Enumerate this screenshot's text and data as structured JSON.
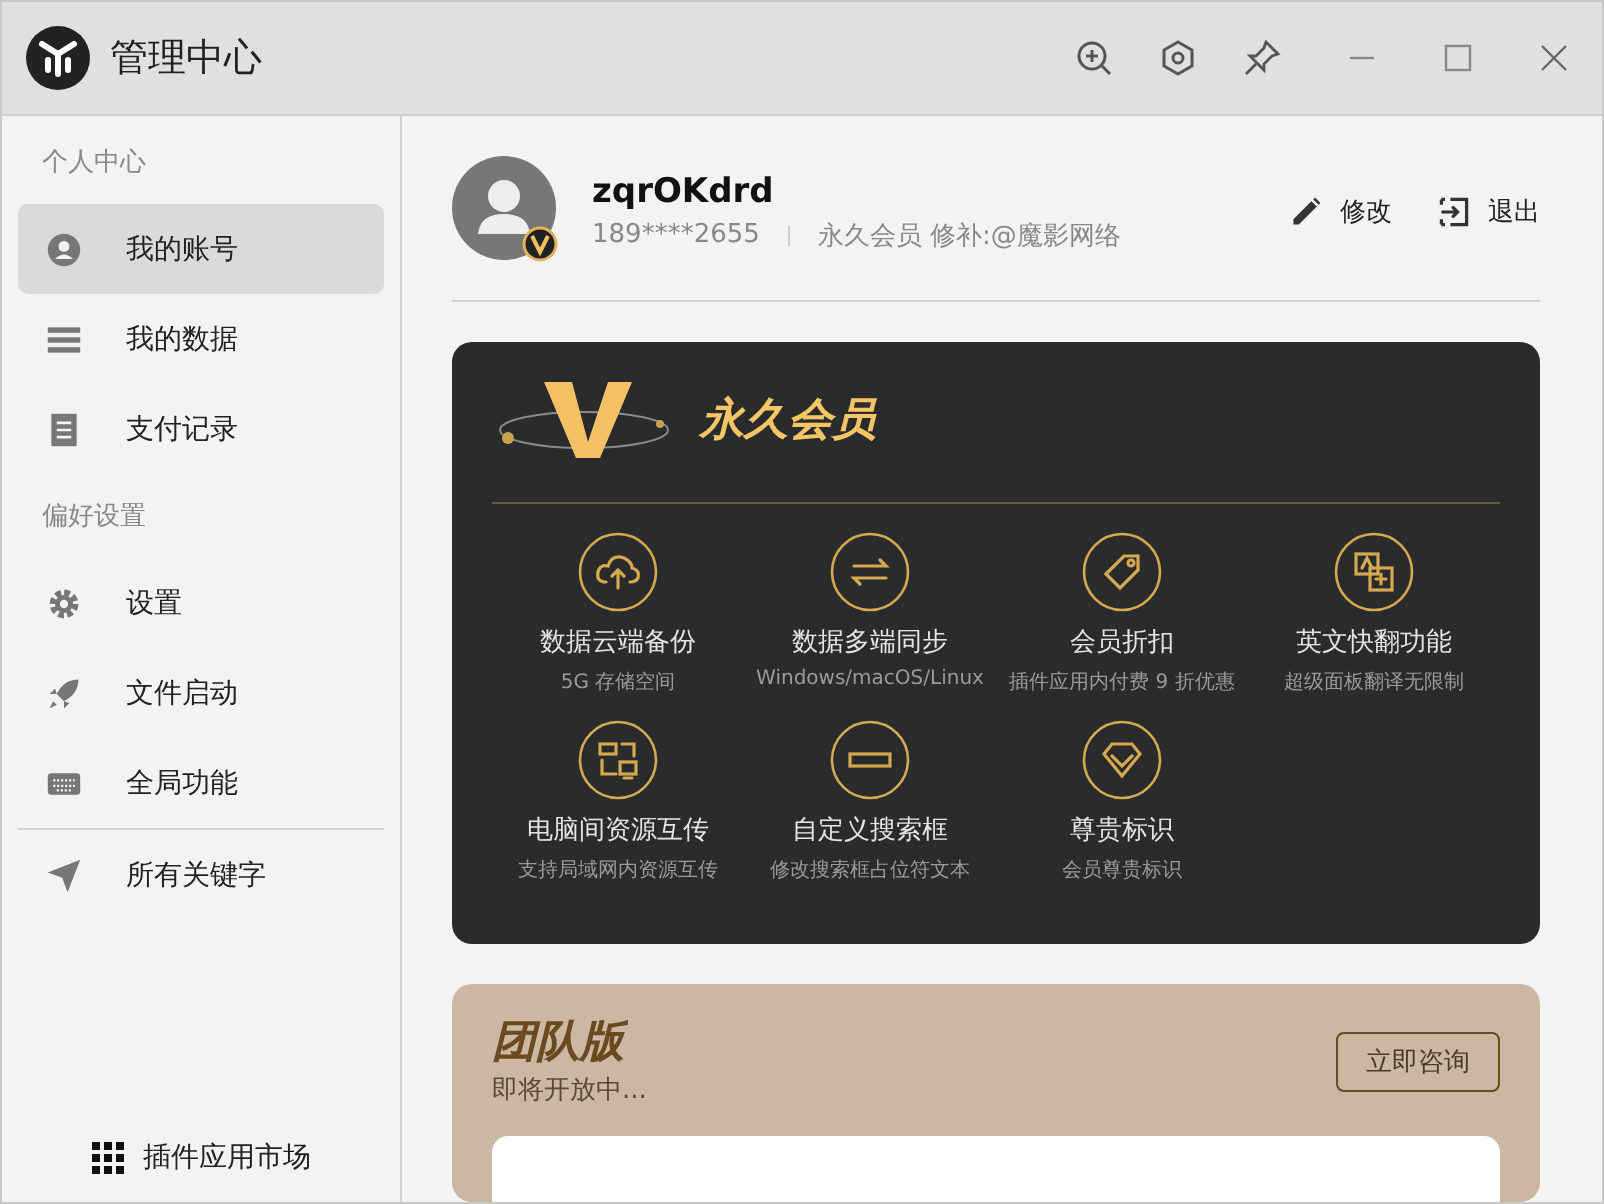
{
  "window": {
    "title": "管理中心"
  },
  "sidebar": {
    "groups": [
      {
        "heading": "个人中心",
        "items": [
          {
            "label": "我的账号",
            "selected": true
          },
          {
            "label": "我的数据",
            "selected": false
          },
          {
            "label": "支付记录",
            "selected": false
          }
        ]
      },
      {
        "heading": "偏好设置",
        "items": [
          {
            "label": "设置",
            "selected": false
          },
          {
            "label": "文件启动",
            "selected": false
          },
          {
            "label": "全局功能",
            "selected": false
          }
        ]
      },
      {
        "items": [
          {
            "label": "所有关键字",
            "selected": false
          }
        ]
      }
    ],
    "footer": "插件应用市场"
  },
  "profile": {
    "name": "zqrOKdrd",
    "phone": "189****2655",
    "membership": "永久会员 修补:@魔影网络",
    "actions": [
      "修改",
      "退出"
    ]
  },
  "vip_card": {
    "title": "永久会员",
    "features": [
      {
        "title": "数据云端备份",
        "subtitle": "5G 存储空间"
      },
      {
        "title": "数据多端同步",
        "subtitle": "Windows/macOS/Linux"
      },
      {
        "title": "会员折扣",
        "subtitle": "插件应用内付费 9 折优惠"
      },
      {
        "title": "英文快翻功能",
        "subtitle": "超级面板翻译无限制"
      },
      {
        "title": "电脑间资源互传",
        "subtitle": "支持局域网内资源互传"
      },
      {
        "title": "自定义搜索框",
        "subtitle": "修改搜索框占位符文本"
      },
      {
        "title": "尊贵标识",
        "subtitle": "会员尊贵标识"
      }
    ]
  },
  "team_card": {
    "title": "团队版",
    "subtitle": "即将开放中...",
    "button": "立即咨询"
  }
}
